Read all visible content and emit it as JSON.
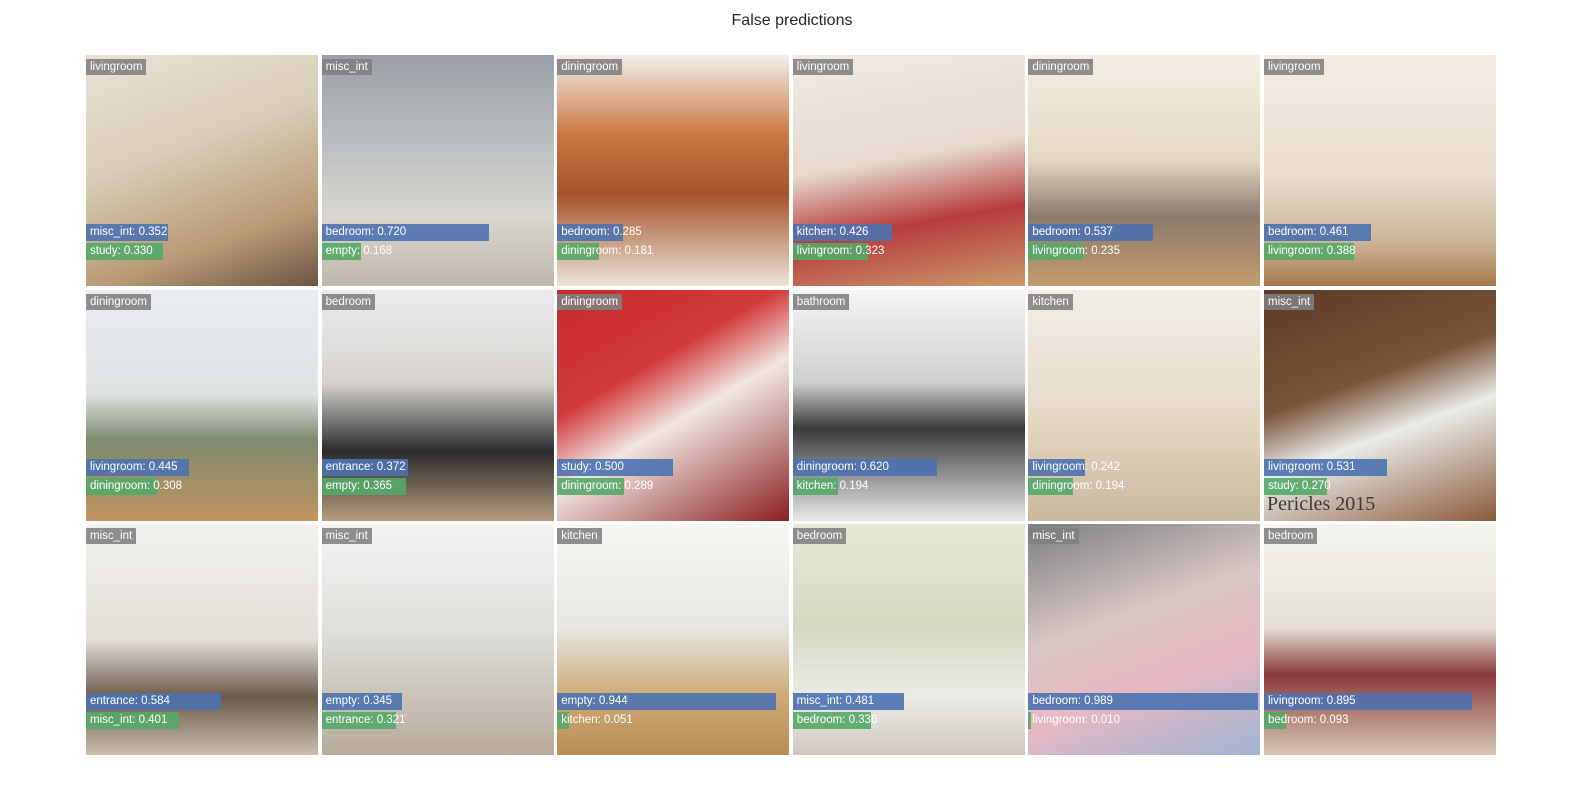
{
  "title": "False predictions",
  "colors": {
    "true_label_bg": "#808080",
    "top_prediction_bar": "#4c72b0",
    "second_prediction_bar": "#55a868"
  },
  "tiles": [
    {
      "true_label": "livingroom",
      "pred1": {
        "label": "misc_int",
        "score": 0.352,
        "text": "misc_int: 0.352"
      },
      "pred2": {
        "label": "study",
        "score": 0.33,
        "text": "study: 0.330"
      }
    },
    {
      "true_label": "misc_int",
      "pred1": {
        "label": "bedroom",
        "score": 0.72,
        "text": "bedroom: 0.720"
      },
      "pred2": {
        "label": "empty",
        "score": 0.168,
        "text": "empty: 0.168"
      }
    },
    {
      "true_label": "diningroom",
      "pred1": {
        "label": "bedroom",
        "score": 0.285,
        "text": "bedroom: 0.285"
      },
      "pred2": {
        "label": "diningroom",
        "score": 0.181,
        "text": "diningroom: 0.181"
      }
    },
    {
      "true_label": "livingroom",
      "pred1": {
        "label": "kitchen",
        "score": 0.426,
        "text": "kitchen: 0.426"
      },
      "pred2": {
        "label": "livingroom",
        "score": 0.323,
        "text": "livingroom: 0.323"
      }
    },
    {
      "true_label": "diningroom",
      "pred1": {
        "label": "bedroom",
        "score": 0.537,
        "text": "bedroom: 0.537"
      },
      "pred2": {
        "label": "livingroom",
        "score": 0.235,
        "text": "livingroom: 0.235"
      }
    },
    {
      "true_label": "livingroom",
      "pred1": {
        "label": "bedroom",
        "score": 0.461,
        "text": "bedroom: 0.461"
      },
      "pred2": {
        "label": "livingroom",
        "score": 0.388,
        "text": "livingroom: 0.388"
      }
    },
    {
      "true_label": "diningroom",
      "pred1": {
        "label": "livingroom",
        "score": 0.445,
        "text": "livingroom: 0.445"
      },
      "pred2": {
        "label": "diningroom",
        "score": 0.308,
        "text": "diningroom: 0.308"
      }
    },
    {
      "true_label": "bedroom",
      "pred1": {
        "label": "entrance",
        "score": 0.372,
        "text": "entrance: 0.372"
      },
      "pred2": {
        "label": "empty",
        "score": 0.365,
        "text": "empty: 0.365"
      }
    },
    {
      "true_label": "diningroom",
      "pred1": {
        "label": "study",
        "score": 0.5,
        "text": "study: 0.500"
      },
      "pred2": {
        "label": "diningroom",
        "score": 0.289,
        "text": "diningroom: 0.289"
      }
    },
    {
      "true_label": "bathroom",
      "pred1": {
        "label": "diningroom",
        "score": 0.62,
        "text": "diningroom: 0.620"
      },
      "pred2": {
        "label": "kitchen",
        "score": 0.194,
        "text": "kitchen: 0.194"
      }
    },
    {
      "true_label": "kitchen",
      "pred1": {
        "label": "livingroom",
        "score": 0.242,
        "text": "livingroom: 0.242"
      },
      "pred2": {
        "label": "diningroom",
        "score": 0.194,
        "text": "diningroom: 0.194"
      }
    },
    {
      "true_label": "misc_int",
      "pred1": {
        "label": "livingroom",
        "score": 0.531,
        "text": "livingroom: 0.531"
      },
      "pred2": {
        "label": "study",
        "score": 0.27,
        "text": "study: 0.270"
      },
      "watermark": "Pericles 2015"
    },
    {
      "true_label": "misc_int",
      "pred1": {
        "label": "entrance",
        "score": 0.584,
        "text": "entrance: 0.584"
      },
      "pred2": {
        "label": "misc_int",
        "score": 0.401,
        "text": "misc_int: 0.401"
      }
    },
    {
      "true_label": "misc_int",
      "pred1": {
        "label": "empty",
        "score": 0.345,
        "text": "empty: 0.345"
      },
      "pred2": {
        "label": "entrance",
        "score": 0.321,
        "text": "entrance: 0.321"
      }
    },
    {
      "true_label": "kitchen",
      "pred1": {
        "label": "empty",
        "score": 0.944,
        "text": "empty: 0.944"
      },
      "pred2": {
        "label": "kitchen",
        "score": 0.051,
        "text": "kitchen: 0.051"
      }
    },
    {
      "true_label": "bedroom",
      "pred1": {
        "label": "misc_int",
        "score": 0.481,
        "text": "misc_int: 0.481"
      },
      "pred2": {
        "label": "bedroom",
        "score": 0.336,
        "text": "bedroom: 0.336"
      }
    },
    {
      "true_label": "misc_int",
      "pred1": {
        "label": "bedroom",
        "score": 0.989,
        "text": "bedroom: 0.989"
      },
      "pred2": {
        "label": "livingroom",
        "score": 0.01,
        "text": "livingroom: 0.010"
      }
    },
    {
      "true_label": "bedroom",
      "pred1": {
        "label": "livingroom",
        "score": 0.895,
        "text": "livingroom: 0.895"
      },
      "pred2": {
        "label": "bedroom",
        "score": 0.093,
        "text": "bedroom: 0.093"
      }
    }
  ]
}
